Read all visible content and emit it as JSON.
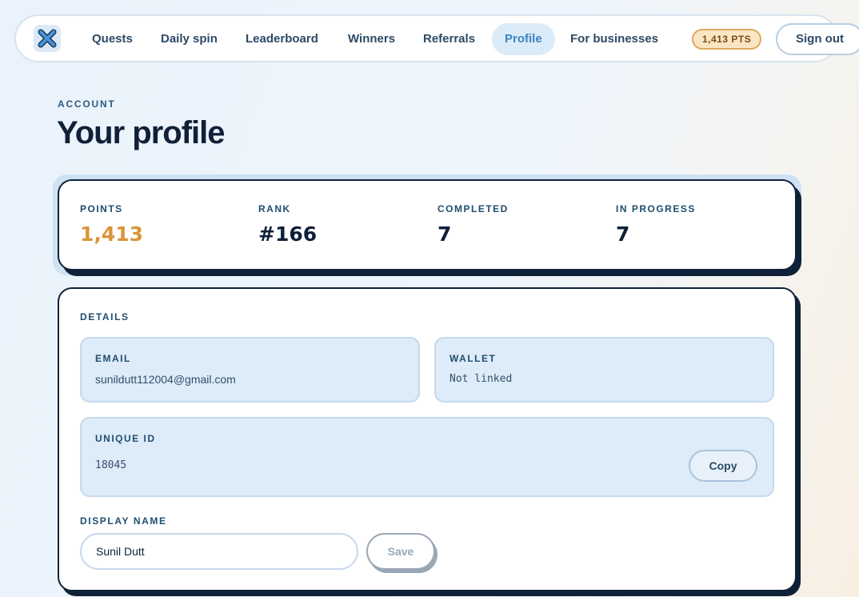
{
  "nav": {
    "items": [
      {
        "label": "Quests"
      },
      {
        "label": "Daily spin"
      },
      {
        "label": "Leaderboard"
      },
      {
        "label": "Winners"
      },
      {
        "label": "Referrals"
      },
      {
        "label": "Profile",
        "active": true
      },
      {
        "label": "For businesses"
      }
    ],
    "points_badge": "1,413 PTS",
    "sign_out": "Sign out",
    "logo_icon": "x-logo-icon"
  },
  "header": {
    "eyebrow": "ACCOUNT",
    "title": "Your profile"
  },
  "stats": [
    {
      "label": "POINTS",
      "value": "1,413"
    },
    {
      "label": "RANK",
      "value": "#166"
    },
    {
      "label": "COMPLETED",
      "value": "7"
    },
    {
      "label": "IN PROGRESS",
      "value": "7"
    }
  ],
  "details": {
    "section_label": "DETAILS",
    "email": {
      "label": "EMAIL",
      "value": "sunildutt112004@gmail.com"
    },
    "wallet": {
      "label": "WALLET",
      "value": "Not linked"
    },
    "unique_id": {
      "label": "UNIQUE ID",
      "value": "18045",
      "copy_label": "Copy"
    },
    "display_name": {
      "label": "DISPLAY NAME",
      "value": "Sunil Dutt",
      "save_label": "Save"
    }
  },
  "colors": {
    "accent_gold": "#d9953a",
    "active_nav": "#3b84c4",
    "ink": "#0f2138"
  }
}
